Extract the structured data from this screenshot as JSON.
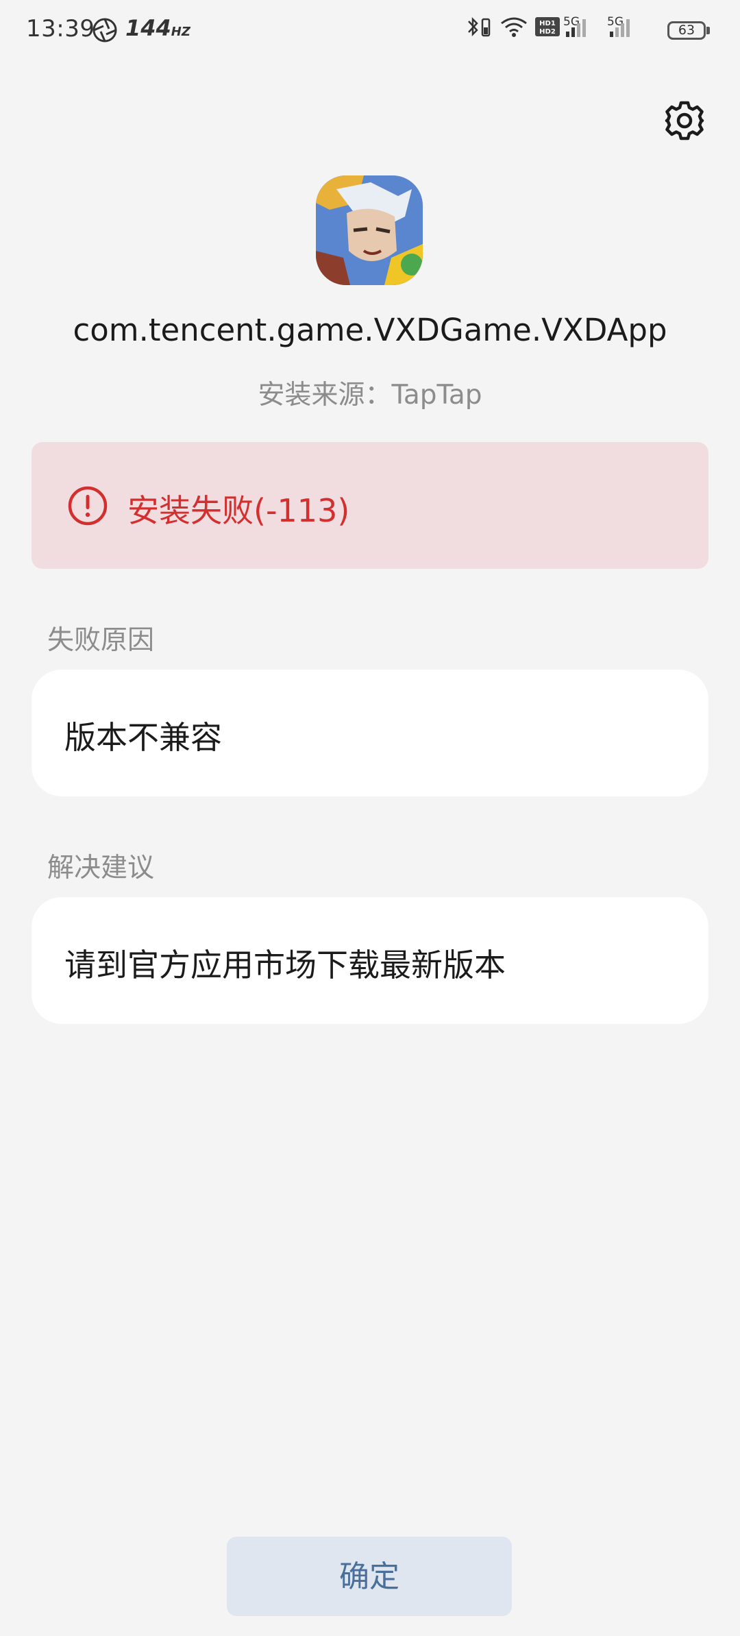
{
  "status_bar": {
    "time": "13:39",
    "refresh_rate": "144",
    "refresh_unit": "HZ",
    "network_1": "5G",
    "network_2": "5G",
    "battery": "63"
  },
  "app": {
    "package_name": "com.tencent.game.VXDGame.VXDApp",
    "install_source": "安装来源：TapTap"
  },
  "error": {
    "message": "安装失败(-113)",
    "color": "#d32f2f"
  },
  "failure_reason": {
    "label": "失败原因",
    "value": "版本不兼容"
  },
  "suggestion": {
    "label": "解决建议",
    "value": "请到官方应用市场下载最新版本"
  },
  "actions": {
    "confirm_label": "确定"
  },
  "icons": {
    "settings": "gear-icon",
    "error": "exclamation-circle-icon",
    "app": "app-icon"
  }
}
